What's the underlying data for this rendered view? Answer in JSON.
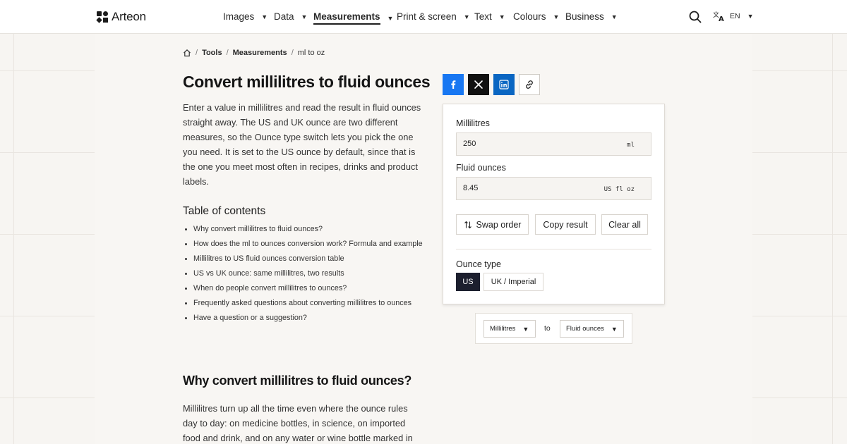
{
  "brand": {
    "name": "Arteon"
  },
  "nav": {
    "items": [
      {
        "label": "Images",
        "active": false
      },
      {
        "label": "Data",
        "active": false
      },
      {
        "label": "Measurements",
        "active": true
      },
      {
        "label": "Print & screen",
        "active": false
      },
      {
        "label": "Text",
        "active": false
      },
      {
        "label": "Colours",
        "active": false
      },
      {
        "label": "Business",
        "active": false
      }
    ],
    "language": "EN",
    "icons": {
      "search": "search-icon",
      "language": "translate-icon"
    }
  },
  "breadcrumb": {
    "home_icon": "home-icon",
    "items": [
      "Tools",
      "Measurements",
      "ml to oz"
    ]
  },
  "page": {
    "title": "Convert millilitres to fluid ounces",
    "intro": "Enter a value in millilitres and read the result in fluid ounces straight away. The US and UK ounce are two different measures, so the Ounce type switch lets you pick the one you need. It is set to the US ounce by default, since that is the one you meet most often in recipes, drinks and product labels.",
    "toc_title": "Table of contents",
    "toc": [
      "Why convert millilitres to fluid ounces?",
      "How does the ml to ounces conversion work? Formula and example",
      "Millilitres to US fluid ounces conversion table",
      "US vs UK ounce: same millilitres, two results",
      "When do people convert millilitres to ounces?",
      "Frequently asked questions about converting millilitres to ounces",
      "Have a question or a suggestion?"
    ],
    "section_title": "Why convert millilitres to fluid ounces?",
    "section_text": "Millilitres turn up all the time even where the ounce rules day to day: on medicine bottles, in science, on imported food and drink, and on any water or wine bottle marked in"
  },
  "share": {
    "icons": [
      "facebook-icon",
      "x-icon",
      "linkedin-icon",
      "link-icon"
    ]
  },
  "converter": {
    "input_label": "Millilitres",
    "input_value": "250",
    "input_unit": "ml",
    "output_label": "Fluid ounces",
    "output_value": "8.45",
    "output_unit": "US fl oz",
    "swap_label": "Swap order",
    "copy_label": "Copy result",
    "clear_label": "Clear all",
    "ounce_type_label": "Ounce type",
    "ounce_options": [
      "US",
      "UK / Imperial"
    ],
    "ounce_selected": "US"
  },
  "unit_picker": {
    "from": "Millilitres",
    "to_word": "to",
    "to": "Fluid ounces"
  },
  "colors": {
    "facebook": "#1877f2",
    "x": "#111111",
    "linkedin": "#0a66c2",
    "selected_segment": "#1c1f2e"
  }
}
